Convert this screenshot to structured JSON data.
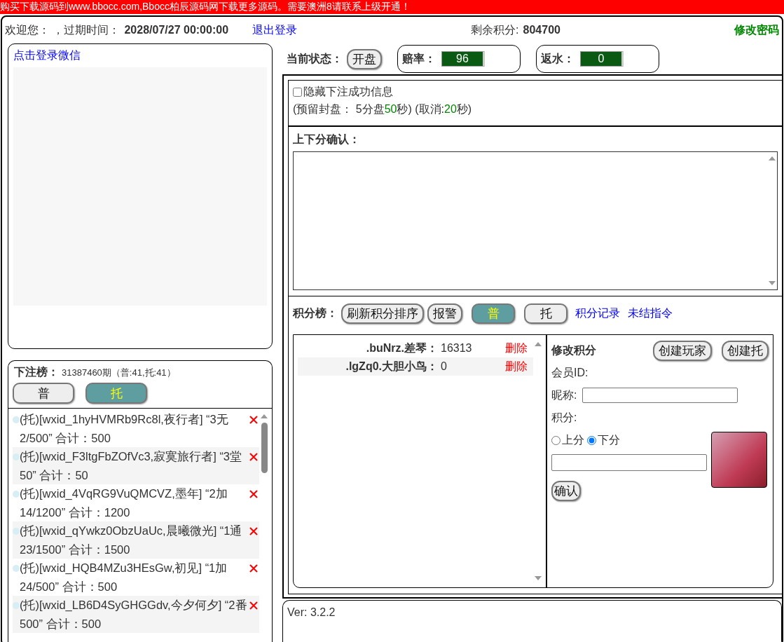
{
  "banner": "购买下载源码到www.bbocc.com,Bbocc柏辰源码网下载更多源码。需要澳洲8请联系上级开通！",
  "header": {
    "welcome": "欢迎您：  ，过期时间：",
    "expire_value": "2028/07/27 00:00:00",
    "logout": "退出登录",
    "balance_label": "剩余积分:",
    "balance_value": "804700",
    "change_password": "修改密码"
  },
  "wechat": {
    "login_link": "点击登录微信"
  },
  "bets": {
    "title": "下注榜：",
    "period": "31387460期（普:41,托:41）",
    "filters": [
      {
        "label": "普",
        "selected": false
      },
      {
        "label": "托",
        "selected": true
      }
    ],
    "items": [
      {
        "text": "(托)[wxid_1hyHVMRb9Rc8l,夜行者] “3无2/500” 合计：500"
      },
      {
        "text": "(托)[wxid_F3ltgFbZOfVc3,寂寞旅行者] “3堂50” 合计：50"
      },
      {
        "text": "(托)[wxid_4VqRG9VuQMCVZ,墨年] “2加14/1200” 合计：1200"
      },
      {
        "text": "(托)[wxid_qYwkz0ObzUaUc,晨曦微光] “1通23/1500” 合计：1500"
      },
      {
        "text": "(托)[wxid_HQB4MZu3HEsGw,初见] “1加24/500” 合计：500"
      },
      {
        "text": "(托)[wxid_LB6D4SyGHGGdv,今夕何夕] “2番500” 合计：500"
      }
    ]
  },
  "status": {
    "label": "当前状态：",
    "state_button": "开盘",
    "odds_label": "赔率：",
    "odds_value": "96",
    "rebate_label": "返水：",
    "rebate_value": "0"
  },
  "options": {
    "hide_success": {
      "label": "隐藏下注成功信息",
      "checked": false
    },
    "close_text": "(预留封盘：  5分盘",
    "close_seconds": "50",
    "cancel_text": "秒)  (取消:",
    "cancel_seconds": "20",
    "suffix": "秒)"
  },
  "confirm": {
    "title": "上下分确认："
  },
  "scores": {
    "title": "积分榜：",
    "buttons": [
      "刷新积分排序",
      "报警"
    ],
    "filters": [
      {
        "label": "普",
        "selected": true
      },
      {
        "label": "托",
        "selected": false
      }
    ],
    "links": [
      "积分记录",
      "未结指令"
    ],
    "rows": [
      {
        "name": ".buNrz.差琴：",
        "score": "16313",
        "action": "删除"
      },
      {
        "name": ".lgZq0.大胆小鸟：",
        "score": "0",
        "action": "删除"
      }
    ]
  },
  "edit": {
    "title": "修改积分",
    "buttons": [
      "创建玩家",
      "创建托"
    ],
    "member_id_label": "会员ID:",
    "nickname_label": "昵称:",
    "points_label": "积分:",
    "directions": [
      {
        "label": "上分",
        "selected": false
      },
      {
        "label": "下分",
        "selected": true
      }
    ],
    "confirm": "确认"
  },
  "version": "Ver: 3.2.2"
}
